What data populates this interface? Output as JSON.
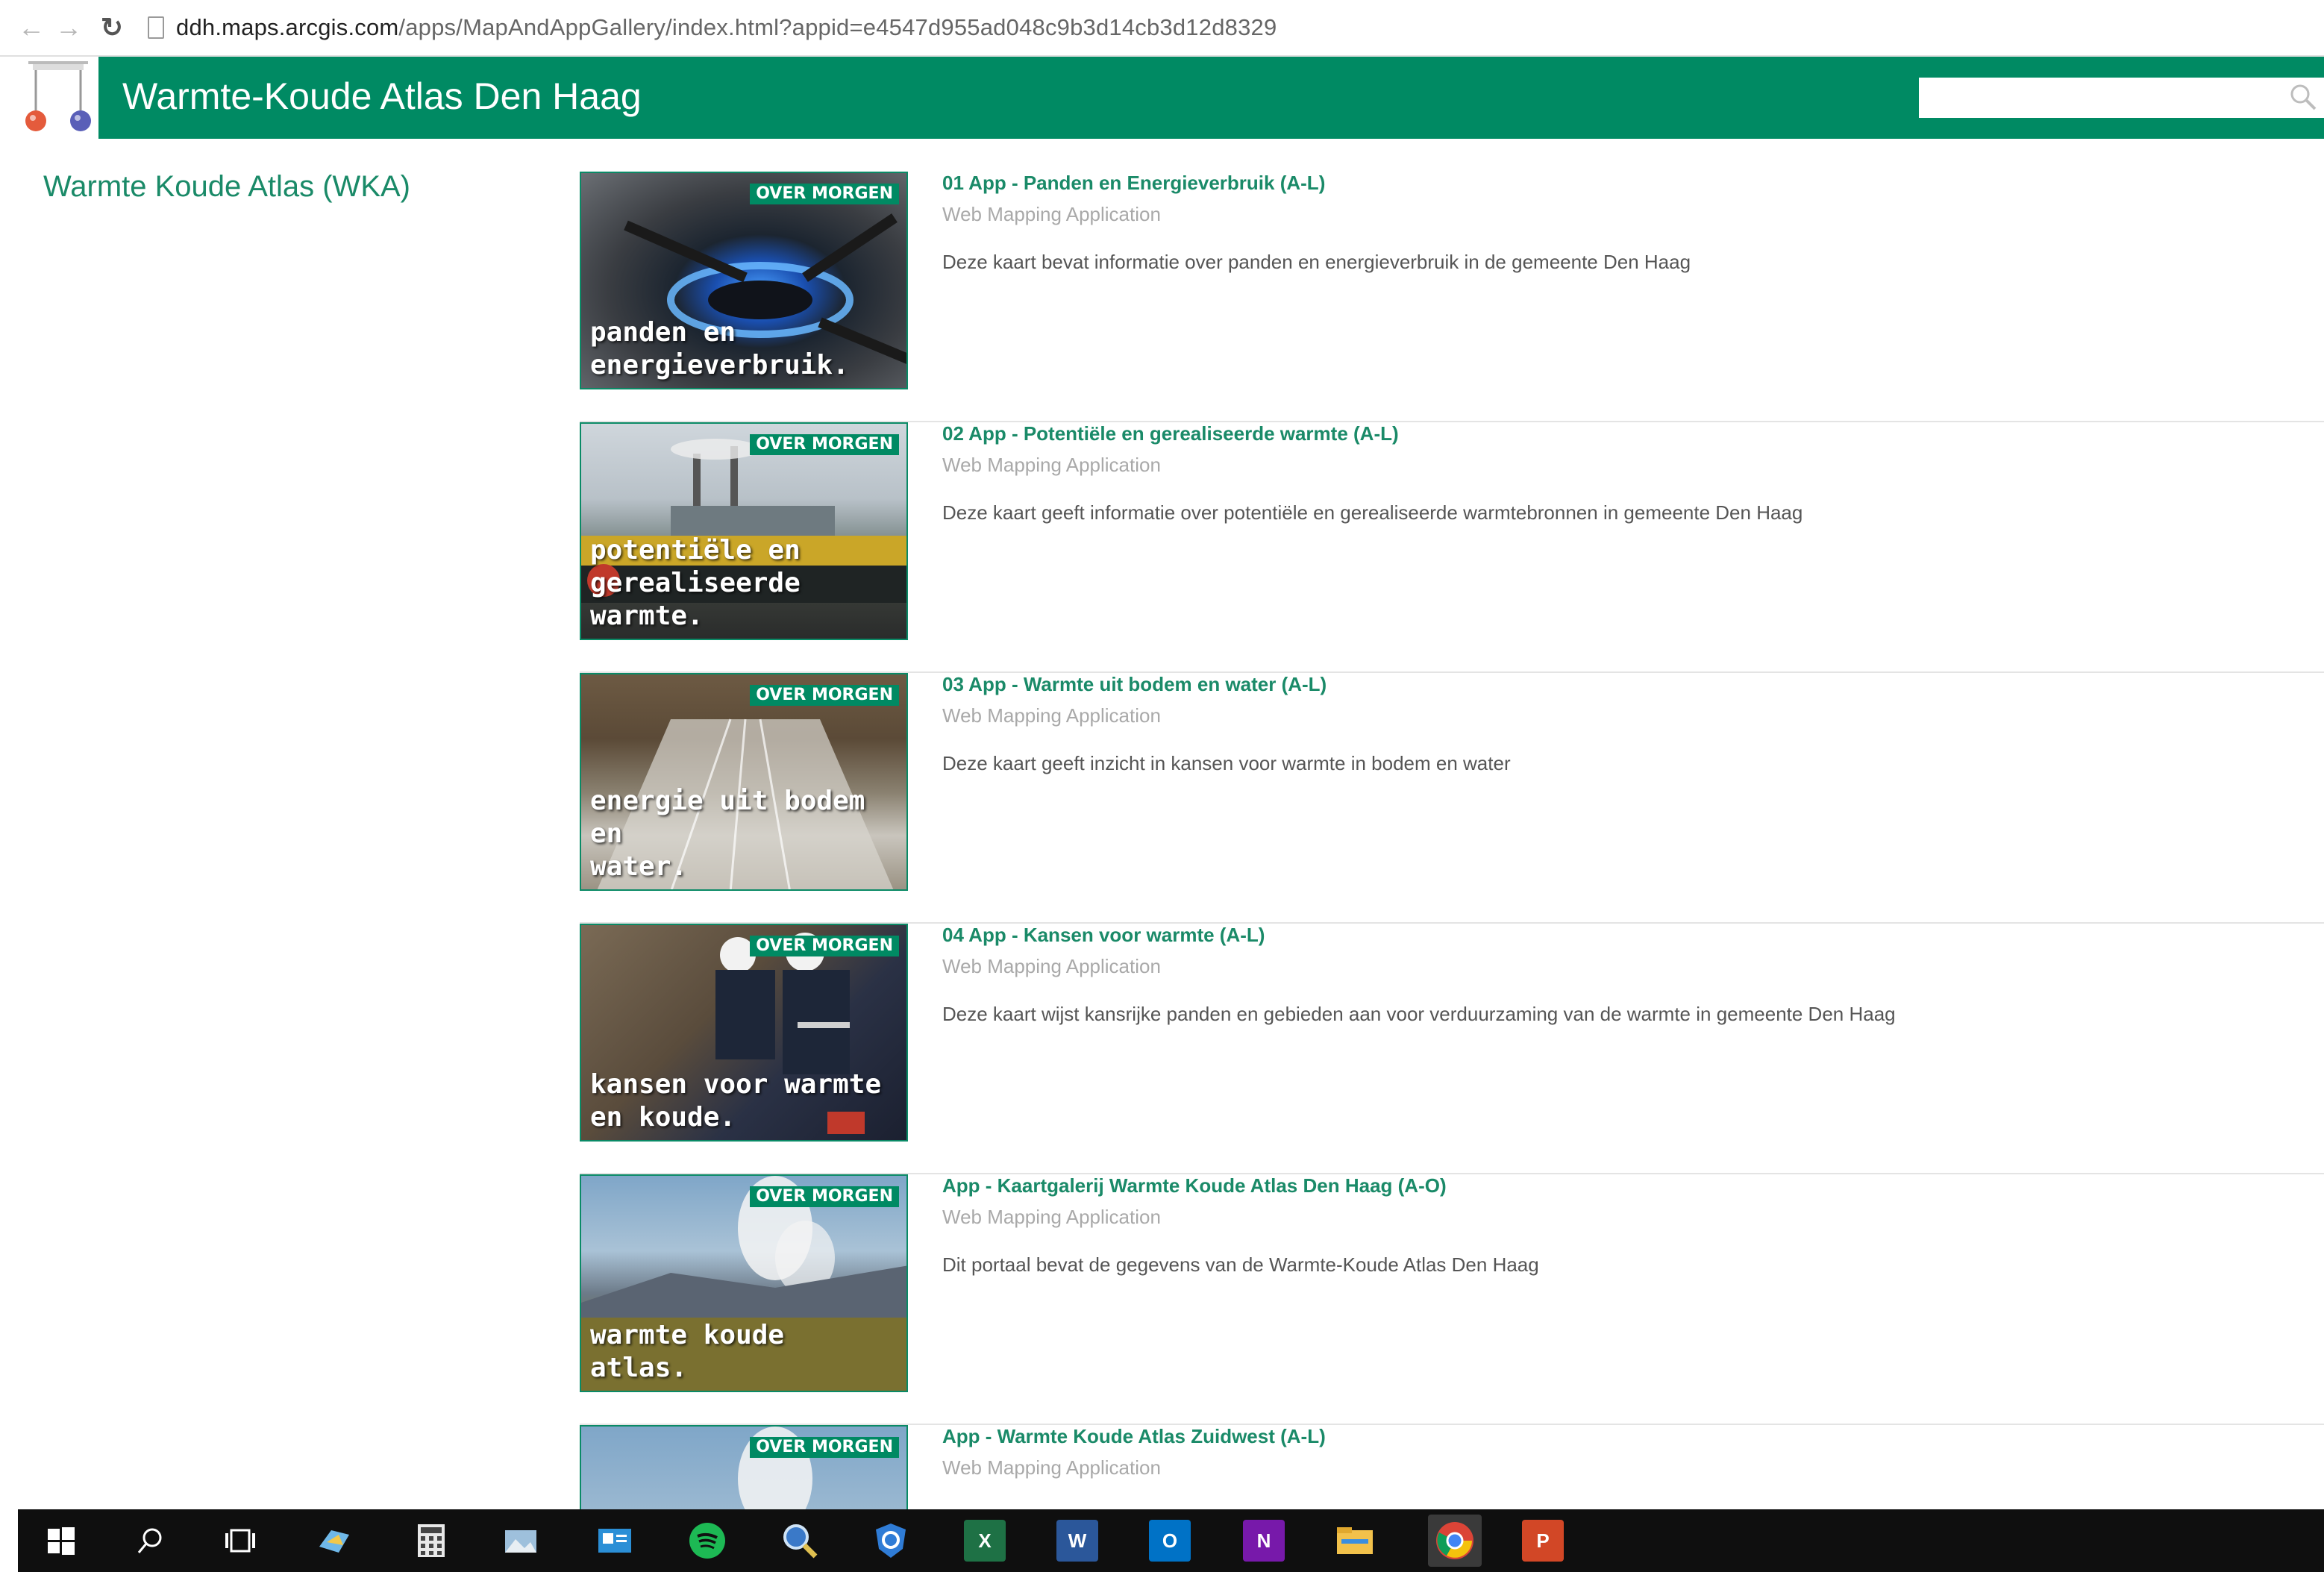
{
  "browser": {
    "url_host": "ddh.maps.arcgis.com",
    "url_path": "/apps/MapAndAppGallery/index.html?appid=e4547d955ad048c9b3d14cb3d12d8329"
  },
  "header": {
    "title": "Warmte-Koude Atlas Den Haag",
    "search_placeholder": ""
  },
  "sidebar": {
    "title": "Warmte Koude Atlas (WKA)"
  },
  "items": [
    {
      "title": "01 App - Panden en Energieverbruik (A-L)",
      "type": "Web Mapping Application",
      "description": "Deze kaart bevat informatie over panden en energieverbruik in de gemeente Den Haag",
      "thumb_badge": "OVER MORGEN",
      "thumb_caption": [
        "panden en",
        "energieverbruik."
      ]
    },
    {
      "title": "02 App - Potentiële en gerealiseerde warmte (A-L)",
      "type": "Web Mapping Application",
      "description": "Deze kaart geeft informatie over potentiële en gerealiseerde warmtebronnen in gemeente Den Haag",
      "thumb_badge": "OVER MORGEN",
      "thumb_caption": [
        "potentiële en",
        "gerealiseerde warmte."
      ]
    },
    {
      "title": "03 App - Warmte uit bodem en water (A-L)",
      "type": "Web Mapping Application",
      "description": "Deze kaart geeft inzicht in kansen voor warmte in bodem en water",
      "thumb_badge": "OVER MORGEN",
      "thumb_caption": [
        "energie uit bodem en",
        "water."
      ]
    },
    {
      "title": "04 App - Kansen voor warmte (A-L)",
      "type": "Web Mapping Application",
      "description": "Deze kaart wijst kansrijke panden en gebieden aan voor verduurzaming van de warmte in gemeente Den Haag",
      "thumb_badge": "OVER MORGEN",
      "thumb_caption": [
        "kansen voor warmte",
        "en koude."
      ]
    },
    {
      "title": "App - Kaartgalerij Warmte Koude Atlas Den Haag (A-O)",
      "type": "Web Mapping Application",
      "description": "Dit portaal bevat de gegevens van de Warmte-Koude Atlas Den Haag",
      "thumb_badge": "OVER MORGEN",
      "thumb_caption": [
        "warmte koude",
        "atlas."
      ]
    },
    {
      "title": "App - Warmte Koude Atlas Zuidwest (A-L)",
      "type": "Web Mapping Application",
      "description": "",
      "thumb_badge": "OVER MORGEN",
      "thumb_caption": []
    }
  ],
  "taskbar": {
    "icons": [
      "start-icon",
      "search-icon",
      "task-view-icon",
      "maps-icon",
      "calculator-icon",
      "photos-icon",
      "outlook-card-icon",
      "spotify-icon",
      "magnifier-icon",
      "shield-icon",
      "excel-icon",
      "word-icon",
      "outlook-icon",
      "onenote-icon",
      "file-explorer-icon",
      "chrome-icon",
      "powerpoint-icon"
    ],
    "colors": {
      "excel": "#1e7145",
      "word": "#2b579a",
      "outlook": "#0072c6",
      "onenote": "#7719aa",
      "powerpoint": "#d24726",
      "spotify": "#1db954"
    },
    "labels": {
      "excel": "X",
      "word": "W",
      "outlook": "O",
      "onenote": "N",
      "powerpoint": "P"
    }
  },
  "colors": {
    "brand_green": "#008a63",
    "title_green": "#1a8a68"
  }
}
